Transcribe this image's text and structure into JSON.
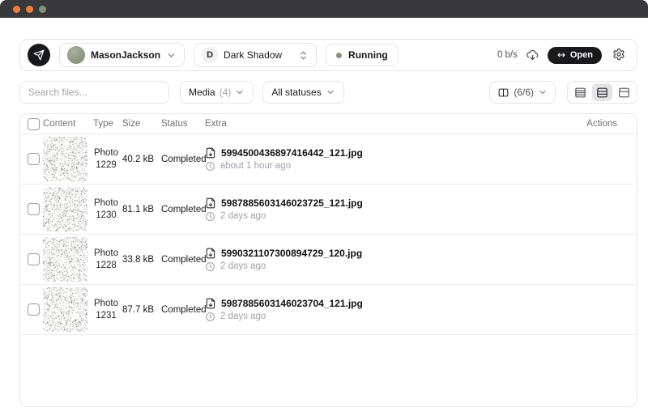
{
  "colors": {
    "titlebar_bg": "#39393b",
    "window_dot_orange": "#ee7d3d",
    "window_dot_gray": "#868e82",
    "border": "#e4e4e7",
    "text_primary": "#18181b",
    "text_muted": "#a1a1aa",
    "open_button_bg": "#1a1a1c",
    "active_segment_bg": "#e4e4e7",
    "status_dot": "#8b9384",
    "avatar_olive": "#8e987f"
  },
  "toolbar": {
    "account_name": "MasonJackson",
    "channel_initial": "D",
    "channel_name": "Dark Shadow",
    "status_label": "Running",
    "speed_label": "0 b/s",
    "open_label": "Open"
  },
  "filters": {
    "search_placeholder": "Search files...",
    "media_label": "Media",
    "media_count": "(4)",
    "statuses_label": "All statuses",
    "columns_count": "(6/6)"
  },
  "table": {
    "headers": {
      "content": "Content",
      "type": "Type",
      "size": "Size",
      "status": "Status",
      "extra": "Extra",
      "actions": "Actions"
    },
    "rows": [
      {
        "type_name": "Photo",
        "type_id": "1229",
        "size": "40.2 kB",
        "status": "Completed",
        "filename": "5994500436897416442_121.jpg",
        "time": "about 1 hour ago"
      },
      {
        "type_name": "Photo",
        "type_id": "1230",
        "size": "81.1 kB",
        "status": "Completed",
        "filename": "5987885603146023725_121.jpg",
        "time": "2 days ago"
      },
      {
        "type_name": "Photo",
        "type_id": "1228",
        "size": "33.8 kB",
        "status": "Completed",
        "filename": "5990321107300894729_120.jpg",
        "time": "2 days ago"
      },
      {
        "type_name": "Photo",
        "type_id": "1231",
        "size": "87.7 kB",
        "status": "Completed",
        "filename": "5987885603146023704_121.jpg",
        "time": "2 days ago"
      }
    ]
  }
}
